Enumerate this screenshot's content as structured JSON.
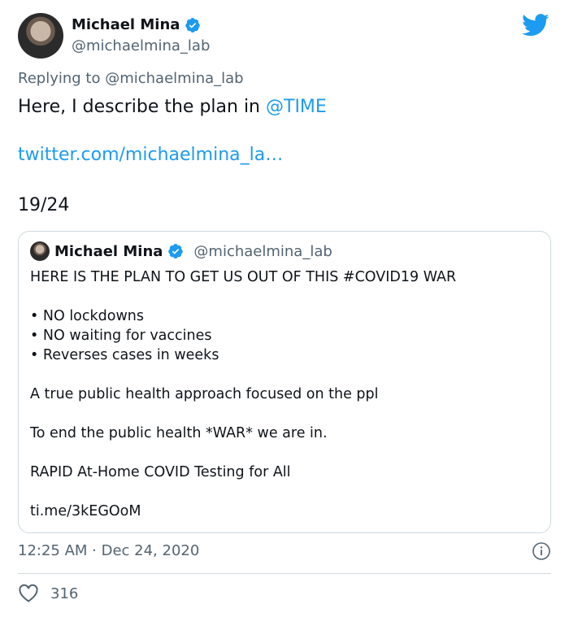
{
  "author": {
    "name": "Michael Mina",
    "handle": "@michaelmina_lab",
    "verified": true
  },
  "reply": {
    "prefix": "Replying to",
    "mention": "@michaelmina_lab"
  },
  "tweet": {
    "text": "Here, I describe the plan in ",
    "mention": "@TIME",
    "link": "twitter.com/michaelmina_la…",
    "counter": "19/24"
  },
  "quoted": {
    "name": "Michael Mina",
    "handle": "@michaelmina_lab",
    "lines": [
      "HERE IS THE PLAN TO GET US OUT OF THIS #COVID19 WAR",
      "",
      "• NO lockdowns",
      "• NO waiting for vaccines",
      "• Reverses cases in weeks",
      "",
      "A true public health approach focused on the ppl",
      "",
      "To end the public health *WAR* we are in.",
      "",
      "RAPID At-Home COVID Testing for All",
      "",
      "ti.me/3kEGOoM"
    ]
  },
  "meta": {
    "timestamp": "12:25 AM · Dec 24, 2020"
  },
  "likes": {
    "count": "316"
  },
  "colors": {
    "accent": "#1d9bf0",
    "secondary_text": "#536471",
    "border": "#cfd9de"
  },
  "icons": [
    "verified-icon",
    "twitter-bird-icon",
    "info-icon",
    "heart-icon"
  ]
}
